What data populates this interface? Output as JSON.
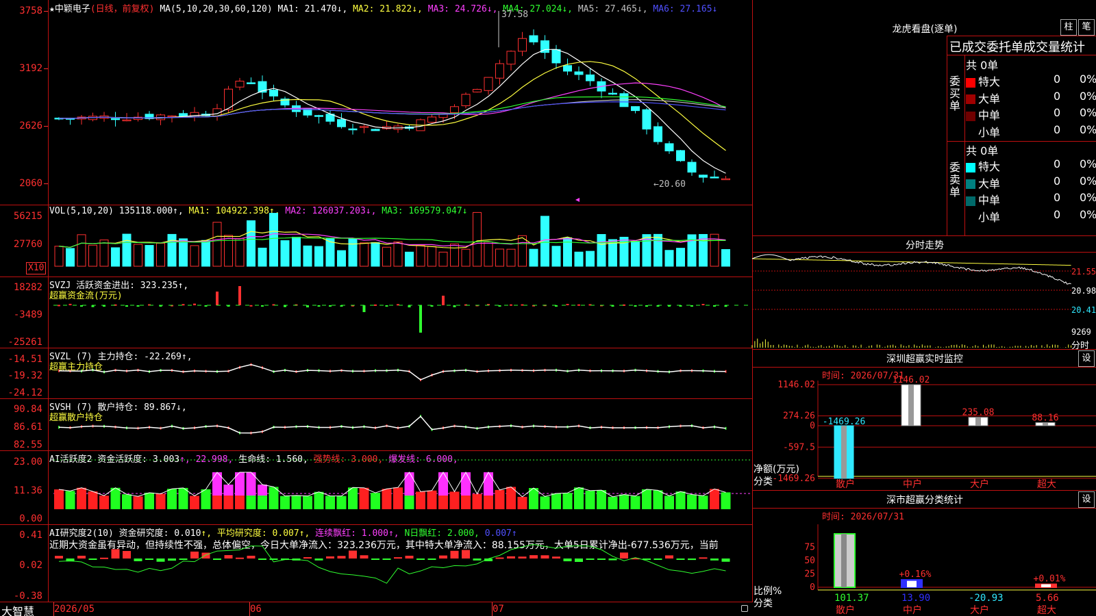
{
  "main": {
    "title_star": "★",
    "stock_name": "中颖电子",
    "period": "(日线，前复权)",
    "ma_label": "MA(5,10,20,30,60,120)",
    "ma1": "MA1: 21.470↓,",
    "ma2": "MA2: 21.822↓,",
    "ma3": "MA3: 24.726↓,",
    "ma4": "MA4: 27.024↓,",
    "ma5": "MA5: 27.465↓,",
    "ma6": "MA6: 27.165↓",
    "y_labels": [
      "3758",
      "3192",
      "2626",
      "2060"
    ],
    "high_marker": "37.58",
    "low_marker": "←20.60"
  },
  "vol": {
    "label": "VOL(5,10,20)",
    "value": "135118.000↑,",
    "ma1": "MA1: 104922.398↑,",
    "ma2": "MA2: 126037.203↓,",
    "ma3": "MA3: 169579.047↓",
    "y_labels": [
      "56215",
      "27760"
    ],
    "unit": "X10"
  },
  "svzj": {
    "line1": "SVZJ  活跃资金进出: 323.235↑,",
    "line2": "超赢资金流(万元)",
    "y_labels": [
      "18282",
      "-3489",
      "-25261"
    ]
  },
  "svzl": {
    "line1": "SVZL (7) 主力持仓: -22.269↑,",
    "line2": "超赢主力持仓",
    "y_labels": [
      "-14.51",
      "-19.32",
      "-24.12"
    ]
  },
  "svsh": {
    "line1": "SVSH (7) 散户持仓: 89.867↓,",
    "line2": "超赢散户持仓",
    "y_labels": [
      "90.84",
      "86.61",
      "82.55"
    ]
  },
  "ai1": {
    "label": "AI活跃度2 资金活跃度: 3.003",
    "v1": "↑, 22.998,",
    "v2": "生命线: 1.560,",
    "v3": "强势线: 3.000,",
    "v4": "爆发线: 6.000,",
    "y_labels": [
      "23.00",
      "11.36",
      "0.00"
    ]
  },
  "ai2": {
    "label": "AI研究度2(10) 资金研究度: 0.010",
    "v1": "↑, 平均研究度: 0.007↑,",
    "v2": "连续飘红: 1.000↑,",
    "v3": "N日飘红: 2.000,",
    "v4": "0.007↑",
    "desc": "近期大资金虽有异动，但持续性不强，总体偏空，今日大单净流入：323.236万元，其中特大单净流入：88.155万元，大单5日累计净出-677.536万元，当前",
    "y_labels": [
      "0.41",
      "0.02",
      "-0.38"
    ]
  },
  "xaxis": {
    "brand": "大智慧",
    "labels": [
      "2026/05",
      "06",
      "07"
    ]
  },
  "right": {
    "lhb_title": "龙虎看盘(逐单)",
    "btn_zhu": "柱",
    "btn_bi": "笔",
    "stat_title": "已成交委托单成交量统计",
    "buy_side": "委买单",
    "sell_side": "委卖单",
    "buy_total": "共 0单",
    "sell_total": "共 0单",
    "buy_rows": [
      {
        "name": "特大",
        "val": "0",
        "pct": "0%",
        "color": "#ff0000"
      },
      {
        "name": "大单",
        "val": "0",
        "pct": "0%",
        "color": "#a00000"
      },
      {
        "name": "中单",
        "val": "0",
        "pct": "0%",
        "color": "#700000"
      },
      {
        "name": "小单",
        "val": "0",
        "pct": "0%",
        "color": ""
      }
    ],
    "sell_rows": [
      {
        "name": "特大",
        "val": "0",
        "pct": "0%",
        "color": "#00ffff"
      },
      {
        "name": "大单",
        "val": "0",
        "pct": "0%",
        "color": "#008080"
      },
      {
        "name": "中单",
        "val": "0",
        "pct": "0%",
        "color": "#006a6a"
      },
      {
        "name": "小单",
        "val": "0",
        "pct": "0%",
        "color": ""
      }
    ],
    "fenshi_title": "分时走势",
    "fenshi_prices": [
      "21.55",
      "20.98",
      "20.41"
    ],
    "fenshi_vol": "9269",
    "fenshi_unit": "分时",
    "sz_title": "深圳超赢实时监控",
    "sz_btn": "设",
    "sz_time": "时间: 2026/07/31",
    "sz_y": [
      "1146.02",
      "274.26",
      "0",
      "-597.5",
      "-1469.26"
    ],
    "sz_values": [
      {
        "cat": "散户",
        "v": -1469.26,
        "label": "-1469.26"
      },
      {
        "cat": "中户",
        "v": 1146.02,
        "label": "1146.02"
      },
      {
        "cat": "大户",
        "v": 235.08,
        "label": "235.08"
      },
      {
        "cat": "超大",
        "v": 88.16,
        "label": "88.16"
      }
    ],
    "sz_axis_label1": "净额(万元)",
    "sz_axis_label2": "分类",
    "cls_title": "深市超赢分类统计",
    "cls_btn": "设",
    "cls_time": "时间: 2026/07/31",
    "cls_y": [
      "75",
      "50",
      "25",
      "0"
    ],
    "cls_axis_label1": "比例%",
    "cls_axis_label2": "分类",
    "cls_values": [
      {
        "cat": "散户",
        "v": 101.37,
        "bottom_label": "101.37",
        "top_label": ""
      },
      {
        "cat": "中户",
        "v": 13.9,
        "bottom_label": "13.90",
        "top_label": "+0.16%"
      },
      {
        "cat": "大户",
        "v": -20.93,
        "bottom_label": "-20.93",
        "top_label": ""
      },
      {
        "cat": "超大",
        "v": 5.66,
        "bottom_label": "5.66",
        "top_label": "+0.01%"
      }
    ]
  },
  "colors": {
    "up": "#ff3030",
    "down": "#30ffff",
    "grid": "#c01010"
  }
}
